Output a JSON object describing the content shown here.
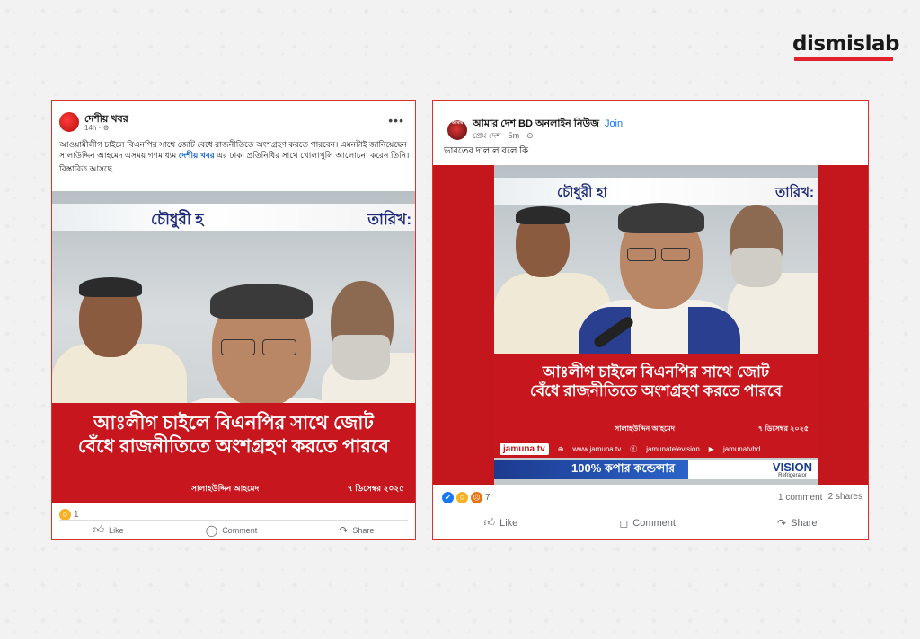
{
  "brand": {
    "logo_text": "dismislab"
  },
  "left_post": {
    "page_name": "দেশীয় খবর",
    "time": "14h · ⚙",
    "avatar_text": "",
    "body_line_1": "আওয়ামীলীগ চাইলে বিএনপির সাথে জোট বেধে রাজনীতিতে অংশগ্রহণ করতে পারবেন। এমনটাই জানিয়েছেন সালাউদ্দিন আহমেদ এসময় গণমাধ্যম ",
    "body_link": "দেশীয় খবর",
    "body_line_2": " এর ঢাকা প্রতিনিধির সাথে খোলাখুলি আলোচনা করেন তিনি।",
    "body_more": "বিস্তারিত আসছে...",
    "banner_text": "চৌধুরী হ",
    "banner_text_right": "তারিখ:",
    "headline_1": "আঃলীগ চাইলে বিএনপির সাথে জোট",
    "headline_2": "বেঁধে রাজনীতিতে অংশগ্রহণ করতে পারবে",
    "speaker": "সালাহউদ্দিন আহমেদ",
    "date": "৭ ডিসেম্বর ২০২৫",
    "reaction_count": "1",
    "actions": {
      "like": "Like",
      "comment": "Comment",
      "share": "Share"
    }
  },
  "right_post": {
    "page_name": "আমার দেশ BD অনলাইন নিউজ",
    "join": "Join",
    "meta": "প্রেম দেশ · 5m · ⊙",
    "avatar_text": "আমার",
    "body": "ভারতের দালাল বলে কি",
    "banner_text": "চৌধুরী হা",
    "banner_text_right": "তারিখ:",
    "headline_1": "আঃলীগ চাইলে বিএনপির সাথে জোট",
    "headline_2": "বেঁধে রাজনীতিতে অংশগ্রহণ করতে পারবে",
    "speaker": "সালাহউদ্দিন আহমেদ",
    "date": "৭ ডিসেম্বর ২০২৫",
    "jamuna": {
      "logo": "jamuna tv",
      "site": "www.jamuna.tv",
      "fb": "jamunatelevision",
      "yt": "jamunatvbd"
    },
    "ad": {
      "text": "100% কপার কন্ডেন্সার",
      "brand": "VISION",
      "brand_sub": "Refrigerator"
    },
    "reaction_count": "7",
    "comments": "1 comment",
    "shares": "2 shares",
    "actions": {
      "like": "Like",
      "comment": "Comment",
      "share": "Share"
    }
  }
}
